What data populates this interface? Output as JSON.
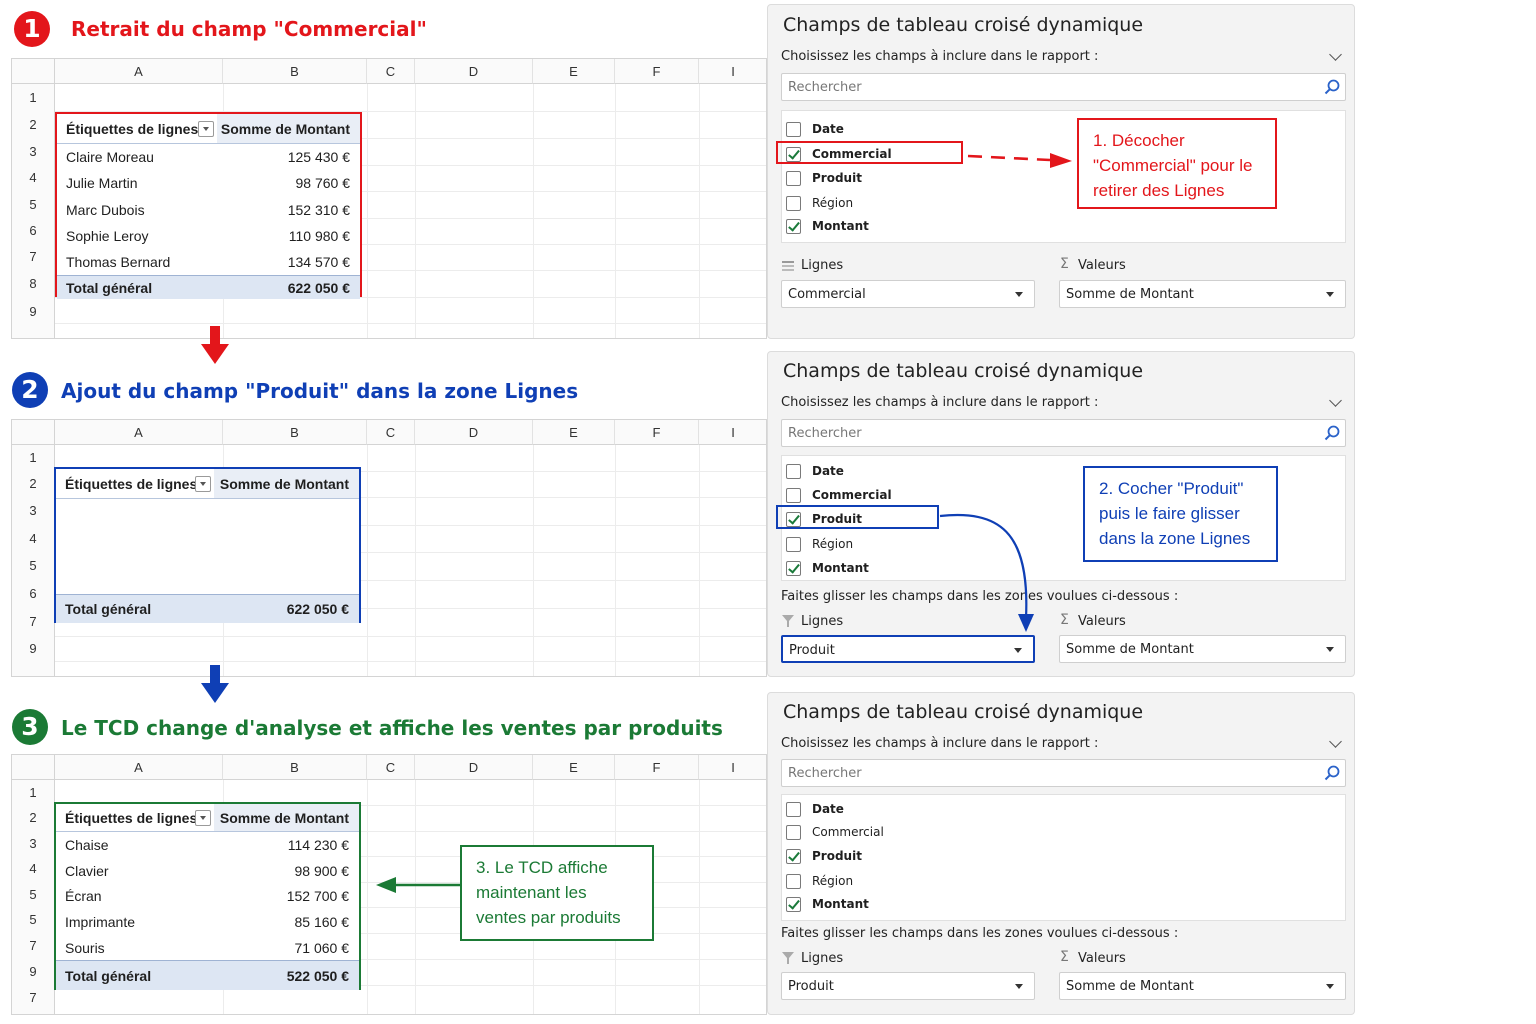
{
  "colors": {
    "red": "#e3161b",
    "blue": "#0f3fb5",
    "green": "#1b7a35"
  },
  "columns": [
    "A",
    "B",
    "C",
    "D",
    "E",
    "F",
    "I"
  ],
  "step1": {
    "number": "1",
    "title": "Retrait du champ \"Commercial\"",
    "rows": [
      "1",
      "2",
      "3",
      "4",
      "5",
      "6",
      "7",
      "8",
      "9"
    ],
    "pivot": {
      "header_label": "Étiquettes de lignes",
      "header_value": "Somme de Montant",
      "items": [
        {
          "label": "Claire Moreau",
          "value": "125 430 €"
        },
        {
          "label": "Julie Martin",
          "value": "98 760 €"
        },
        {
          "label": "Marc Dubois",
          "value": "152 310 €"
        },
        {
          "label": "Sophie Leroy",
          "value": "110 980 €"
        },
        {
          "label": "Thomas Bernard",
          "value": "134 570 €"
        }
      ],
      "total_label": "Total général",
      "total_value": "622 050 €"
    },
    "panel": {
      "title": "Champs de tableau croisé dynamique",
      "subtitle": "Choisissez les champs à inclure dans le rapport :",
      "search_placeholder": "Rechercher",
      "fields": [
        {
          "label": "Date",
          "checked": false
        },
        {
          "label": "Commercial",
          "checked": true
        },
        {
          "label": "Produit",
          "checked": false
        },
        {
          "label": "Région",
          "checked": false
        },
        {
          "label": "Montant",
          "checked": true
        }
      ],
      "rows_zone_label": "Lignes",
      "values_zone_label": "Valeurs",
      "rows_zone_value": "Commercial",
      "values_zone_value": "Somme de Montant"
    },
    "callout": "1. Décocher \"Commercial\" pour le retirer des Lignes"
  },
  "step2": {
    "number": "2",
    "title": "Ajout du champ \"Produit\" dans la zone Lignes",
    "rows": [
      "1",
      "2",
      "3",
      "4",
      "5",
      "6",
      "7",
      "9"
    ],
    "pivot": {
      "header_label": "Étiquettes de lignes",
      "header_value": "Somme de Montant",
      "total_label": "Total général",
      "total_value": "622 050 €"
    },
    "panel": {
      "title": "Champs de tableau croisé dynamique",
      "subtitle": "Choisissez les champs à inclure dans le rapport :",
      "search_placeholder": "Rechercher",
      "fields": [
        {
          "label": "Date",
          "checked": false
        },
        {
          "label": "Commercial",
          "checked": false
        },
        {
          "label": "Produit",
          "checked": true
        },
        {
          "label": "Région",
          "checked": false
        },
        {
          "label": "Montant",
          "checked": true
        }
      ],
      "drag_hint": "Faites glisser les champs dans les zones voulues ci-dessous :",
      "rows_zone_label": "Lignes",
      "values_zone_label": "Valeurs",
      "rows_zone_value": "Produit",
      "values_zone_value": "Somme de Montant"
    },
    "callout": "2. Cocher \"Produit\" puis le faire glisser dans la zone Lignes"
  },
  "step3": {
    "number": "3",
    "title": "Le TCD change d'analyse et affiche les ventes par produits",
    "rows": [
      "1",
      "2",
      "3",
      "4",
      "5",
      "5",
      "7",
      "9",
      "7"
    ],
    "pivot": {
      "header_label": "Étiquettes de lignes",
      "header_value": "Somme de Montant",
      "items": [
        {
          "label": "Chaise",
          "value": "114 230 €"
        },
        {
          "label": "Clavier",
          "value": "98 900 €"
        },
        {
          "label": "Écran",
          "value": "152 700 €"
        },
        {
          "label": "Imprimante",
          "value": "85 160 €"
        },
        {
          "label": "Souris",
          "value": "71 060 €"
        }
      ],
      "total_label": "Total général",
      "total_value": "522 050 €"
    },
    "panel": {
      "title": "Champs de tableau croisé dynamique",
      "subtitle": "Choisissez les champs à inclure dans le rapport :",
      "search_placeholder": "Rechercher",
      "fields": [
        {
          "label": "Date",
          "checked": false
        },
        {
          "label": "Commercial",
          "checked": false
        },
        {
          "label": "Produit",
          "checked": true
        },
        {
          "label": "Région",
          "checked": false
        },
        {
          "label": "Montant",
          "checked": true
        }
      ],
      "drag_hint": "Faites glisser les champs dans les zones voulues ci-dessous :",
      "rows_zone_label": "Lignes",
      "values_zone_label": "Valeurs",
      "rows_zone_value": "Produit",
      "values_zone_value": "Somme de Montant"
    },
    "callout": "3. Le TCD affiche maintenant les ventes par produits"
  }
}
